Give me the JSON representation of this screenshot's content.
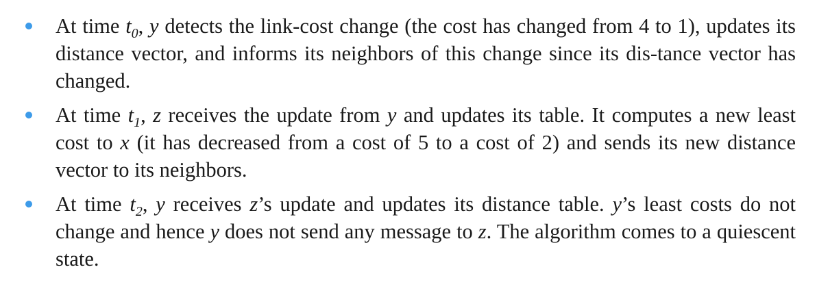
{
  "bullets": [
    {
      "parts": [
        {
          "t": "At time "
        },
        {
          "t": "t",
          "italic": true
        },
        {
          "t": "0",
          "sub": true
        },
        {
          "t": ", "
        },
        {
          "t": "y",
          "italic": true
        },
        {
          "t": " detects the link-cost change (the cost has changed from 4 to 1), updates its distance vector, and informs its neighbors of this change since its dis-tance vector has changed."
        }
      ]
    },
    {
      "parts": [
        {
          "t": "At time "
        },
        {
          "t": "t",
          "italic": true
        },
        {
          "t": "1",
          "sub": true
        },
        {
          "t": ", "
        },
        {
          "t": "z",
          "italic": true
        },
        {
          "t": " receives the update from "
        },
        {
          "t": "y",
          "italic": true
        },
        {
          "t": " and updates its table. It computes a new least cost to "
        },
        {
          "t": "x",
          "italic": true
        },
        {
          "t": " (it has decreased from a cost of 5 to a cost of 2) and sends its new distance vector to its neighbors."
        }
      ]
    },
    {
      "parts": [
        {
          "t": "At time "
        },
        {
          "t": "t",
          "italic": true
        },
        {
          "t": "2",
          "sub": true
        },
        {
          "t": ", "
        },
        {
          "t": "y",
          "italic": true
        },
        {
          "t": " receives "
        },
        {
          "t": "z",
          "italic": true
        },
        {
          "t": "’s update and updates its distance table. "
        },
        {
          "t": "y",
          "italic": true
        },
        {
          "t": "’s least costs do not change and hence "
        },
        {
          "t": "y",
          "italic": true
        },
        {
          "t": " does not send any message to "
        },
        {
          "t": "z",
          "italic": true
        },
        {
          "t": ". The algorithm comes to a quiescent state."
        }
      ]
    }
  ],
  "colors": {
    "bullet": "#3d9be9",
    "text": "#1a1a1a"
  }
}
